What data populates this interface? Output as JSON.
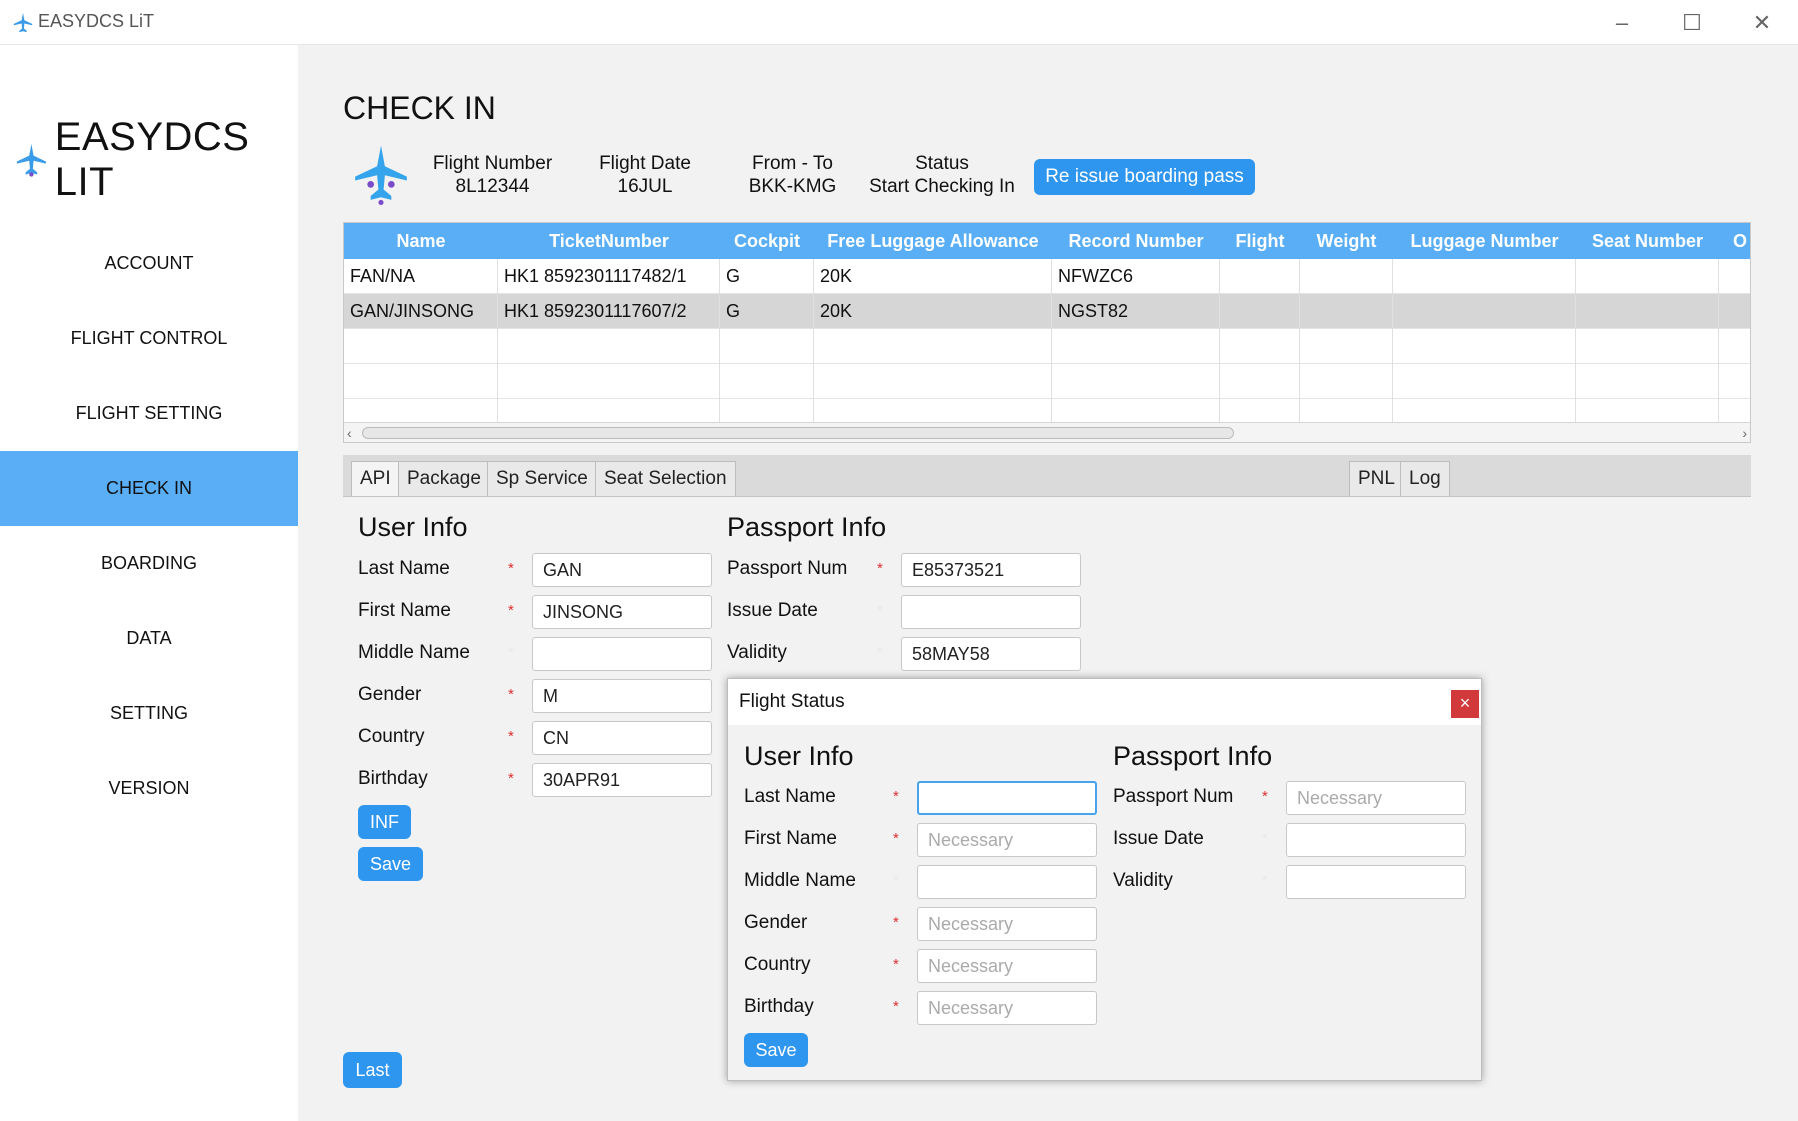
{
  "window": {
    "title": "EASYDCS LiT"
  },
  "sidebar": {
    "brand": "EASYDCS LIT",
    "items": [
      {
        "label": "ACCOUNT"
      },
      {
        "label": "FLIGHT CONTROL"
      },
      {
        "label": "FLIGHT SETTING"
      },
      {
        "label": "CHECK IN"
      },
      {
        "label": "BOARDING"
      },
      {
        "label": "DATA"
      },
      {
        "label": "SETTING"
      },
      {
        "label": "VERSION"
      }
    ]
  },
  "page": {
    "title": "CHECK IN"
  },
  "flight_info": {
    "flight_number_label": "Flight Number",
    "flight_number": "8L12344",
    "flight_date_label": "Flight Date",
    "flight_date": "16JUL",
    "route_label": "From - To",
    "route": "BKK-KMG",
    "status_label": "Status",
    "status": "Start Checking In",
    "reissue_button": "Re issue boarding pass"
  },
  "table": {
    "columns": [
      "Name",
      "TicketNumber",
      "Cockpit",
      "Free Luggage Allowance",
      "Record Number",
      "Flight",
      "Weight",
      "Luggage Number",
      "Seat Number",
      "O"
    ],
    "rows": [
      [
        "FAN/NA",
        "HK1 8592301117482/1",
        "G",
        "20K",
        "NFWZC6",
        "",
        "",
        "",
        ""
      ],
      [
        "GAN/JINSONG",
        "HK1 8592301117607/2",
        "G",
        "20K",
        "NGST82",
        "",
        "",
        "",
        ""
      ]
    ]
  },
  "tabs": {
    "api": "API",
    "package": "Package",
    "sp_service": "Sp Service",
    "seat_selection": "Seat Selection",
    "pnl": "PNL",
    "log": "Log"
  },
  "form": {
    "user_info_title": "User Info",
    "passport_info_title": "Passport Info",
    "required_mark": "*",
    "labels": {
      "last_name": "Last Name",
      "first_name": "First Name",
      "middle_name": "Middle Name",
      "gender": "Gender",
      "country": "Country",
      "birthday": "Birthday",
      "passport_num": "Passport Num",
      "issue_date": "Issue Date",
      "validity": "Validity"
    },
    "values": {
      "last_name": "GAN",
      "first_name": "JINSONG",
      "middle_name": "",
      "gender": "M",
      "country": "CN",
      "birthday": "30APR91",
      "passport_num": "E85373521",
      "issue_date": "",
      "validity": "58MAY58"
    },
    "inf_button": "INF",
    "save_button": "Save"
  },
  "last_button": "Last",
  "dialog": {
    "title": "Flight Status",
    "close": "×",
    "user_info_title": "User Info",
    "passport_info_title": "Passport Info",
    "placeholder": "Necessary",
    "save_button": "Save"
  },
  "colors": {
    "accent": "#5aaef5",
    "button": "#2f96f0",
    "required": "#e03030",
    "close": "#d2393b"
  }
}
